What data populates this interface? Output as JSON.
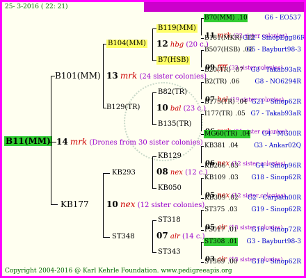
{
  "header": {
    "date": "25- 3-2016 ( 22: 21)"
  },
  "watermark": {
    "text": "pedigreeapis"
  },
  "root": {
    "id": "B11(MM)"
  },
  "lvl1": {
    "drones": {
      "num": "14",
      "mark": "mrk",
      "note": "(Drones from 30 sister colonies)"
    },
    "queen": {
      "id": "B101(MM)",
      "num": "13",
      "mark": "mrk",
      "note": "(24 sister colonies)"
    },
    "other": {
      "id": "KB177",
      "num": "10",
      "mark": "nex",
      "note": "(12 sister colonies)"
    }
  },
  "lvl2": {
    "b104": {
      "id": "B104(MM)",
      "num": "12",
      "mark": "hbg",
      "note": "(20 c.)"
    },
    "b129": {
      "id": "B129(TR)",
      "num": "10",
      "mark": "bal",
      "note": "(23 c.)"
    },
    "kb293": {
      "id": "KB293",
      "num": "08",
      "mark": "nex",
      "note": "(12 c.)"
    },
    "st348": {
      "id": "ST348",
      "num": "07",
      "mark": "alr",
      "note": "(14 c.)"
    }
  },
  "lvl3": [
    {
      "id": "B119(MM)",
      "num": "11",
      "mark": "mrk",
      "note": "(22 sister colonies)",
      "hl": "y"
    },
    {
      "id": "B7(HSB)",
      "num": "09",
      "mark": "ffff",
      "note": "(33 sister colonies)",
      "hl": "y"
    },
    {
      "id": "B82(TR)",
      "num": "07",
      "mark": "bal",
      "note": "(19 sister colonies)",
      "hl": ""
    },
    {
      "id": "B135(TR)",
      "num": "06",
      "mark": "mrk",
      "note": "(21 sister colonies)",
      "hl": ""
    },
    {
      "id": "KB129",
      "num": "06",
      "mark": "nex",
      "note": "(12 sister colonies)",
      "hl": ""
    },
    {
      "id": "KB050",
      "num": "05",
      "mark": "nex",
      "note": "(12 sister colonies)",
      "hl": ""
    },
    {
      "id": "ST318",
      "num": "05",
      "mark": "alr",
      "note": "(13 sister colonies)",
      "hl": ""
    },
    {
      "id": "ST343",
      "num": "03",
      "mark": "alr",
      "note": "(13 sister colonies)",
      "hl": ""
    }
  ],
  "lvl4": [
    {
      "id": "B70(MM)",
      "val": ".10",
      "loc": "G6 - EO537",
      "hl": "g"
    },
    {
      "id": "B181(MKR)",
      "val": ".12",
      "loc": "G12 - SinopEgg86R",
      "hl": ""
    },
    {
      "id": "B507(HSB)",
      "val": ".08",
      "loc": "G5 - Bayburt98-3",
      "hl": ""
    },
    {
      "id": "B20(TR)",
      "val": ".07",
      "loc": "G8 - Takab93aR",
      "hl": ""
    },
    {
      "id": "B2(TR)",
      "val": ".06",
      "loc": "G8 - NO6294R",
      "hl": ""
    },
    {
      "id": "B175(TR)",
      "val": ".04",
      "loc": "G21 - Sinop62R",
      "hl": ""
    },
    {
      "id": "I177(TR)",
      "val": ".05",
      "loc": "G7 - Takab93aR",
      "hl": ""
    },
    {
      "id": "MG60(TR)",
      "val": ".04",
      "loc": "G4 - MG00R",
      "hl": "g"
    },
    {
      "id": "KB381",
      "val": ".04",
      "loc": "G3 - Ankar02Q",
      "hl": ""
    },
    {
      "id": "KB266",
      "val": ".03",
      "loc": "G4 - Sinop96R",
      "hl": ""
    },
    {
      "id": "KB109",
      "val": ".03",
      "loc": "G18 - Sinop62R",
      "hl": ""
    },
    {
      "id": "KB309",
      "val": ".02",
      "loc": "G2 - Carpath00R",
      "hl": ""
    },
    {
      "id": "ST375",
      "val": ".03",
      "loc": "G19 - Sinop62R",
      "hl": ""
    },
    {
      "id": "PS017",
      "val": ".01",
      "loc": "G16 - Sinop72R",
      "hl": ""
    },
    {
      "id": "ST308",
      "val": ".01",
      "loc": "G3 - Bayburt98-3",
      "hl": "g"
    },
    {
      "id": "ST369",
      "val": ".00",
      "loc": "G18 - Sinop62R",
      "hl": ""
    }
  ],
  "footer": {
    "text": "Copyright 2004-2016 @ Karl Kehrle Foundation.   www.pedigreeapis.org"
  }
}
